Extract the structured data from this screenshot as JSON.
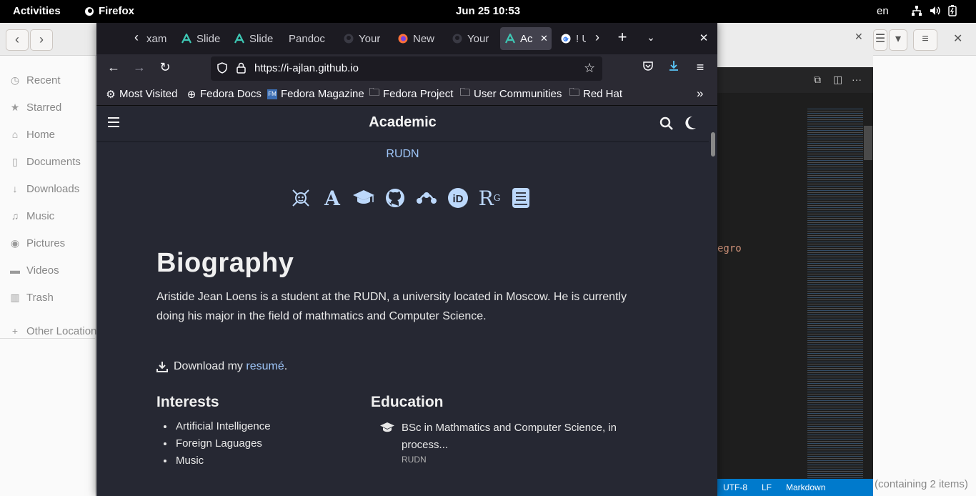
{
  "topbar": {
    "activities": "Activities",
    "app_name": "Firefox",
    "clock": "Jun 25  10:53",
    "lang": "en"
  },
  "files": {
    "sidebar": [
      {
        "icon": "clock-icon",
        "label": "Recent"
      },
      {
        "icon": "star-icon",
        "label": "Starred"
      },
      {
        "icon": "home-icon",
        "label": "Home"
      },
      {
        "icon": "document-icon",
        "label": "Documents"
      },
      {
        "icon": "download-icon",
        "label": "Downloads"
      },
      {
        "icon": "music-icon",
        "label": "Music"
      },
      {
        "icon": "camera-icon",
        "label": "Pictures"
      },
      {
        "icon": "video-icon",
        "label": "Videos"
      },
      {
        "icon": "trash-icon",
        "label": "Trash"
      },
      {
        "icon": "plus-icon",
        "label": "Other Locations"
      }
    ],
    "status": "(containing 2 items)"
  },
  "code": {
    "snippet": "egro",
    "status": [
      "UTF-8",
      "LF",
      "Markdown"
    ]
  },
  "browser": {
    "tabs": [
      {
        "label": "xam",
        "icon": "none"
      },
      {
        "label": "Slides",
        "icon": "academic-icon"
      },
      {
        "label": "Slides",
        "icon": "academic-icon"
      },
      {
        "label": "Pandoc",
        "icon": "none"
      },
      {
        "label": "Your",
        "icon": "github-icon"
      },
      {
        "label": "New",
        "icon": "firefox-icon"
      },
      {
        "label": "Your",
        "icon": "github-icon"
      },
      {
        "label": "Ac",
        "icon": "academic-icon"
      },
      {
        "label": "! U",
        "icon": "google-icon"
      }
    ],
    "url": "https://i-ajlan.github.io",
    "bookmarks": [
      {
        "label": "Most Visited",
        "icon": "gear-icon"
      },
      {
        "label": "Fedora Docs",
        "icon": "globe-icon"
      },
      {
        "label": "Fedora Magazine",
        "icon": "fm-icon"
      },
      {
        "label": "Fedora Project",
        "icon": "folder-icon"
      },
      {
        "label": "User Communities",
        "icon": "folder-icon"
      },
      {
        "label": "Red Hat",
        "icon": "folder-icon"
      }
    ]
  },
  "site": {
    "brand": "Academic",
    "organization": "RUDN",
    "social_icons": [
      "robot-icon",
      "academia-icon",
      "graduation-cap-icon",
      "github-icon",
      "mendeley-icon",
      "orcid-icon",
      "researchgate-icon",
      "book-icon"
    ],
    "bio_heading": "Biography",
    "bio_text": "Aristide Jean Loens is a student at the RUDN, a university located in Moscow. He is currently doing his major in the field of mathmatics and Computer Science.",
    "download_prefix": "Download my",
    "download_link": "resumé",
    "download_suffix": ".",
    "interests_heading": "Interests",
    "interests": [
      "Artificial Intelligence",
      "Foreign Laguages",
      "Music"
    ],
    "education_heading": "Education",
    "education_title": "BSc in Mathmatics and Computer Science, in process...",
    "education_org": "RUDN"
  }
}
